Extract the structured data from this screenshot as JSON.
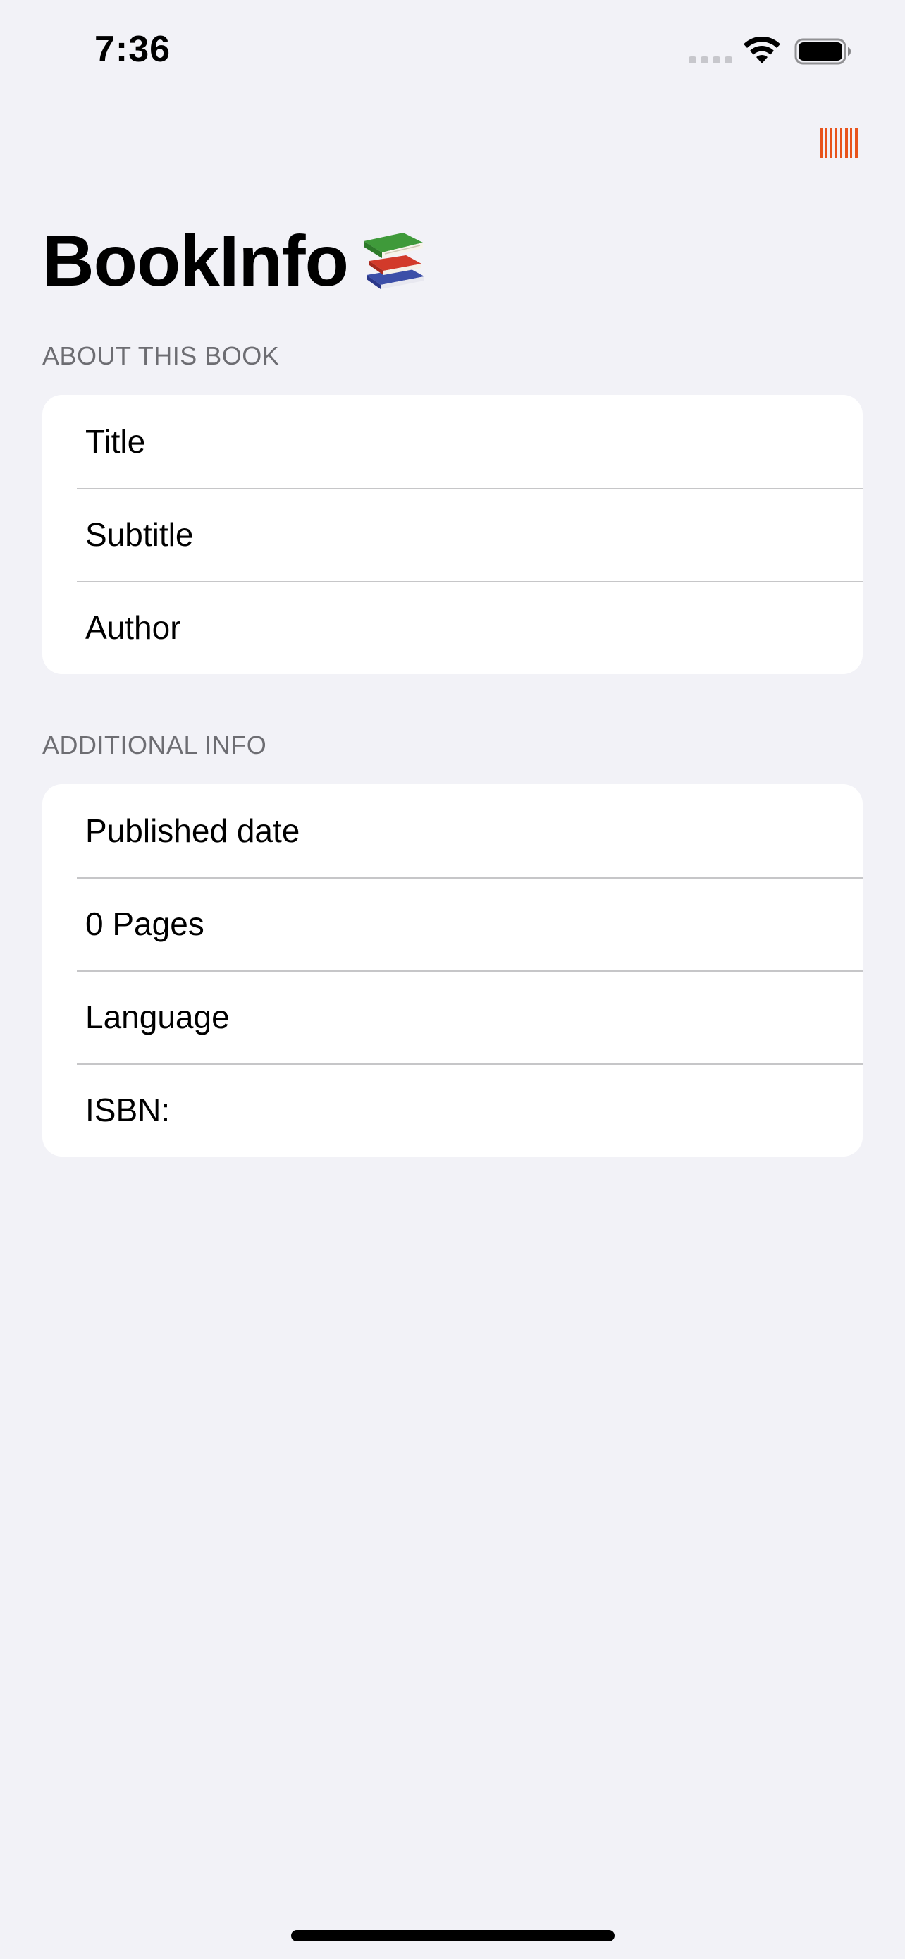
{
  "status_bar": {
    "time": "7:36",
    "icons": [
      "cellular-signal-icon",
      "wifi-icon",
      "battery-icon"
    ]
  },
  "nav_bar": {
    "scan_button_icon": "barcode-icon",
    "accent_color": "#e8541c"
  },
  "page": {
    "title": "BookInfo",
    "title_icon": "books-emoji-icon"
  },
  "sections": {
    "about": {
      "header": "ABOUT THIS BOOK",
      "fields": {
        "title": "Title",
        "subtitle": "Subtitle",
        "author": "Author"
      }
    },
    "additional": {
      "header": "ADDITIONAL INFO",
      "fields": {
        "published_date": "Published date",
        "pages": "0 Pages",
        "language": "Language",
        "isbn": "ISBN:"
      }
    }
  },
  "colors": {
    "background": "#f2f2f7",
    "card": "#ffffff",
    "secondary_text": "#6d6d72",
    "separator": "#c6c6c8"
  }
}
